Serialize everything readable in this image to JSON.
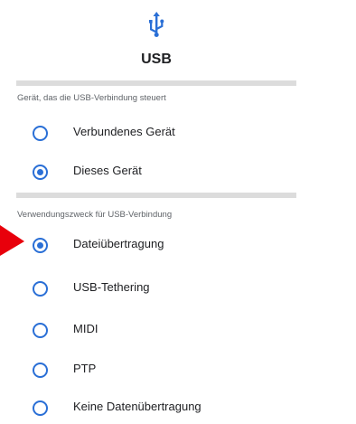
{
  "title": "USB",
  "icons": {
    "usb": "usb-icon",
    "pointer": "red-arrow-pointer"
  },
  "colors": {
    "accent": "#2a6fd6",
    "divider": "#dcdcdc",
    "pointer": "#e8000b"
  },
  "sections": [
    {
      "label": "Gerät, das die USB-Verbindung steuert",
      "options": [
        {
          "label": "Verbundenes Gerät",
          "selected": false
        },
        {
          "label": "Dieses Gerät",
          "selected": true
        }
      ]
    },
    {
      "label": "Verwendungszweck für USB-Verbindung",
      "options": [
        {
          "label": "Dateiübertragung",
          "selected": true
        },
        {
          "label": "USB-Tethering",
          "selected": false
        },
        {
          "label": "MIDI",
          "selected": false
        },
        {
          "label": "PTP",
          "selected": false
        },
        {
          "label": "Keine Datenübertragung",
          "selected": false
        }
      ]
    }
  ]
}
